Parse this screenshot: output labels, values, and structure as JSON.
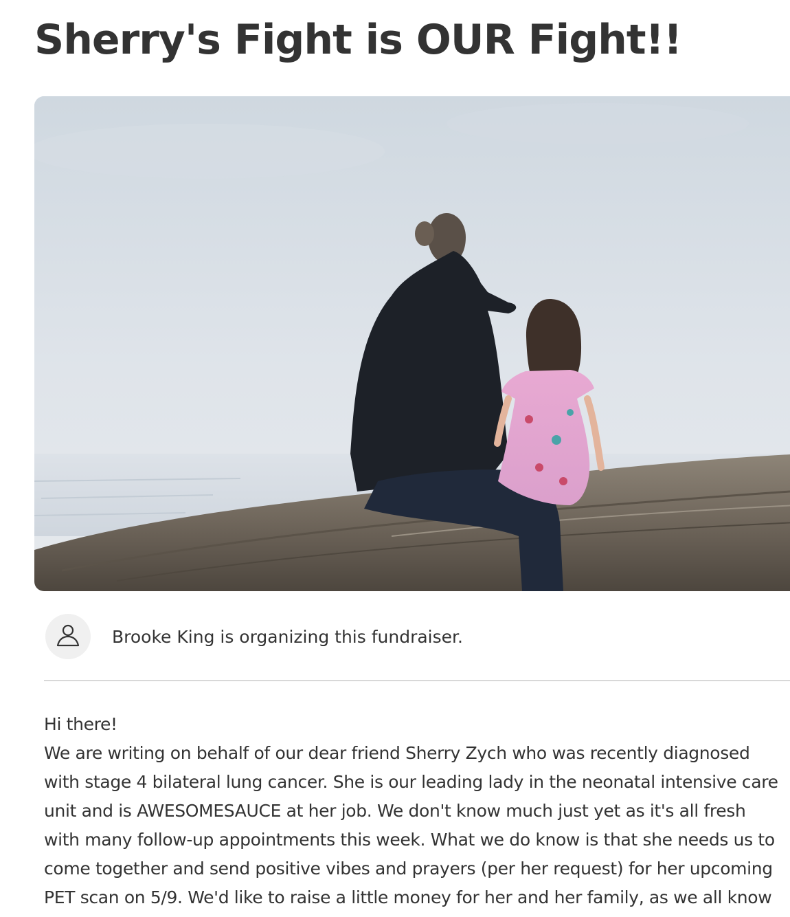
{
  "campaign": {
    "title": "Sherry's Fight is OUR Fight!!"
  },
  "hero": {
    "image_description": ""
  },
  "organizer": {
    "icon": "user-icon",
    "text": "Brooke King is organizing this fundraiser."
  },
  "story": {
    "lines": [
      "Hi there!",
      "We are writing on behalf of our dear friend Sherry Zych who was recently diagnosed",
      "with stage 4 bilateral lung cancer. She is our leading lady in the neonatal intensive care",
      "unit and is AWESOMESAUCE at her job. We don't know much just yet as it's all fresh",
      "with many follow-up appointments this week. What we do know is that she needs us to",
      "come together and send positive vibes and prayers (per her request) for her upcoming",
      "PET scan on 5/9. We'd like to raise a little money for her and her family, as we all know"
    ]
  },
  "colors": {
    "text": "#333333",
    "divider": "#d8d8d8",
    "avatar_bg": "#f0f0f0"
  }
}
